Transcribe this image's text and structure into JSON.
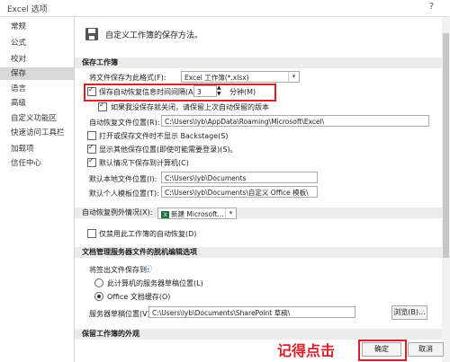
{
  "window": {
    "title": "Excel 选项",
    "help": "?"
  },
  "sidebar": {
    "items": [
      {
        "label": "常规"
      },
      {
        "label": "公式"
      },
      {
        "label": "校对"
      },
      {
        "label": "保存",
        "active": true
      },
      {
        "label": "语言"
      },
      {
        "label": "高级"
      },
      {
        "label": "自定义功能区"
      },
      {
        "label": "快速访问工具栏"
      },
      {
        "label": "加载项"
      },
      {
        "label": "信任中心"
      }
    ]
  },
  "header": {
    "text": "自定义工作簿的保存方法。"
  },
  "save_workbooks": {
    "section_title": "保存工作簿",
    "format_label": "将文件保存为此格式(F):",
    "format_value": "Excel 工作簿(*.xlsx)",
    "autorecover_label": "保存自动恢复信息时间间隔(A)",
    "autorecover_value": "3",
    "minutes_label": "分钟(M)",
    "keep_last_label": "如果我没保存就关闭，请保留上次自动保留的版本",
    "autorecover_location_label": "自动恢复文件位置(R):",
    "autorecover_location_value": "C:\\Users\\lyb\\AppData\\Roaming\\Microsoft\\Excel\\",
    "backstage_label": "打开或保存文件时不显示 Backstage(S)",
    "show_other_label": "显示其他保存位置(即使可能需要登录)(S)。",
    "default_computer_label": "默认情况下保存到计算机(C)",
    "local_location_label": "默认本地文件位置(I):",
    "local_location_value": "C:\\Users\\lyb\\Documents",
    "template_location_label": "默认个人模板位置(T):",
    "template_location_value": "C:\\Users\\lyb\\Documents\\自定义 Office 模板\\"
  },
  "autorecover_exceptions": {
    "label": "自动恢复例外情况(X):",
    "workbook_value": "新建 Microsoft...",
    "disable_label": "仅禁用此工作簿的自动恢复(D)"
  },
  "offline_editing": {
    "section_title": "文档管理服务器文件的脱机编辑选项",
    "save_to_label": "将签出文件保存到:",
    "option_server": "此计算机的服务器草稿位置(L)",
    "option_cache": "Office 文档缓存(O)",
    "drafts_label": "服务器草稿位置(V):",
    "drafts_value": "C:\\Users\\lyb\\Documents\\SharePoint 草稿\\",
    "browse_label": "浏览(B)..."
  },
  "appearance": {
    "section_title": "保留工作簿的外观"
  },
  "footer": {
    "ok_label": "确定",
    "cancel_label": "取消"
  },
  "annotation": {
    "text": "记得点击"
  },
  "colors": {
    "highlight": "#d9202a",
    "active_bg": "#d8d8d8",
    "section_bg": "#ececec"
  }
}
